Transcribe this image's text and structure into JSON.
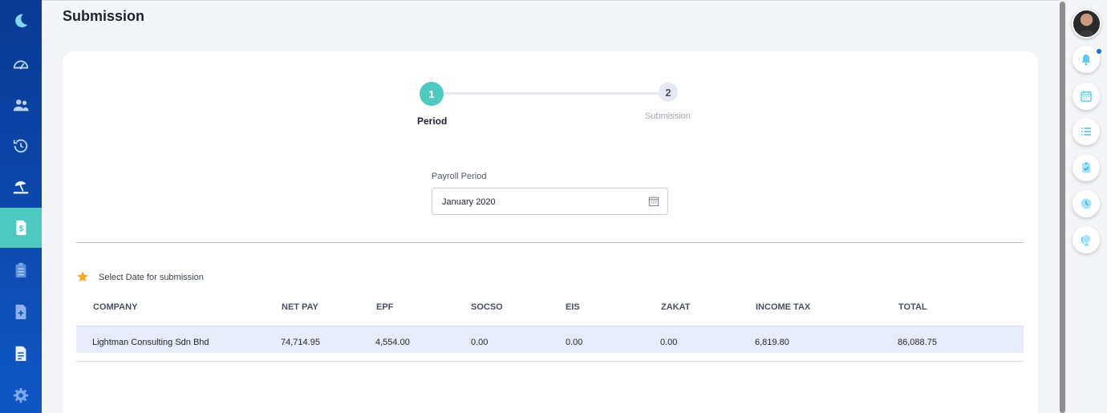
{
  "page": {
    "title": "Submission"
  },
  "sidebar": {
    "items": [
      {
        "icon": "moon-logo-icon"
      },
      {
        "icon": "speedometer-icon"
      },
      {
        "icon": "people-icon"
      },
      {
        "icon": "history-icon"
      },
      {
        "icon": "beach-umbrella-icon"
      },
      {
        "icon": "dollar-document-icon",
        "active": true
      },
      {
        "icon": "clipboard-list-icon"
      },
      {
        "icon": "add-document-icon"
      },
      {
        "icon": "document-lines-icon"
      },
      {
        "icon": "gear-icon"
      }
    ]
  },
  "stepper": {
    "steps": [
      {
        "number": "1",
        "label": "Period"
      },
      {
        "number": "2",
        "label": "Submission"
      }
    ]
  },
  "payroll_period": {
    "label": "Payroll Period",
    "value": "January 2020"
  },
  "select_date": {
    "text": "Select Date for submission"
  },
  "table": {
    "headers": [
      "COMPANY",
      "NET PAY",
      "EPF",
      "SOCSO",
      "EIS",
      "ZAKAT",
      "INCOME TAX",
      "TOTAL"
    ],
    "rows": [
      [
        "Lightman Consulting Sdn Bhd",
        "74,714.95",
        "4,554.00",
        "0.00",
        "0.00",
        "0.00",
        "6,819.80",
        "86,088.75"
      ]
    ]
  },
  "right_rail": {
    "items": [
      "bell-icon",
      "calendar-icon",
      "list-icon",
      "clipboard-check-icon",
      "clock-icon",
      "globe-icon"
    ]
  },
  "colors": {
    "sidebar": "#0f4fbd",
    "accent": "#4ec9c0",
    "rail_icon": "#5fc8f0"
  }
}
